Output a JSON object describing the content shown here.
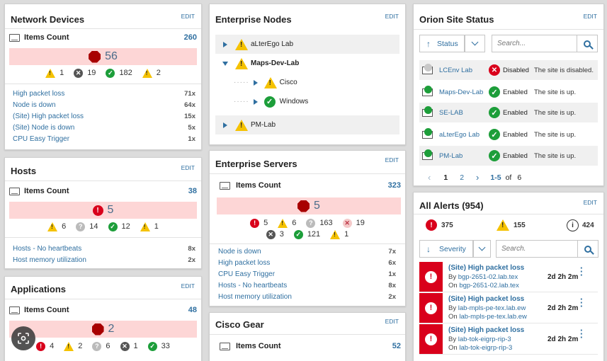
{
  "edit_label": "EDIT",
  "network_devices": {
    "title": "Network Devices",
    "count_label": "Items Count",
    "count_value": "260",
    "critical": "56",
    "stats": {
      "warning": "1",
      "unknown": "19",
      "ok": "182",
      "warning2": "2"
    },
    "alerts": [
      {
        "name": "High packet loss",
        "count": "71x"
      },
      {
        "name": "Node is down",
        "count": "64x"
      },
      {
        "name": "(Site) High packet loss",
        "count": "15x"
      },
      {
        "name": "(Site) Node is down",
        "count": "5x"
      },
      {
        "name": "CPU Easy Trigger",
        "count": "1x"
      }
    ]
  },
  "hosts": {
    "title": "Hosts",
    "count_label": "Items Count",
    "count_value": "38",
    "critical": "5",
    "stats": {
      "warning": "6",
      "unknown": "14",
      "ok": "12",
      "warning2": "1"
    },
    "alerts": [
      {
        "name": "Hosts - No heartbeats",
        "count": "8x"
      },
      {
        "name": "Host memory utilization",
        "count": "2x"
      }
    ]
  },
  "applications": {
    "title": "Applications",
    "count_label": "Items Count",
    "count_value": "48",
    "critical": "2",
    "stats": {
      "error": "4",
      "warning": "2",
      "unknown": "6",
      "down": "1",
      "ok": "33"
    }
  },
  "enterprise_nodes": {
    "title": "Enterprise Nodes",
    "items": [
      {
        "label": "aLterEgo Lab"
      },
      {
        "label": "Maps-Dev-Lab"
      },
      {
        "label": "Cisco"
      },
      {
        "label": "Windows"
      },
      {
        "label": "PM-Lab"
      }
    ]
  },
  "enterprise_servers": {
    "title": "Enterprise Servers",
    "count_label": "Items Count",
    "count_value": "323",
    "critical": "5",
    "stats": {
      "error": "5",
      "warning": "6",
      "unknown": "163",
      "x": "19",
      "down": "3",
      "ok": "121",
      "warning2": "1"
    },
    "alerts": [
      {
        "name": "Node is down",
        "count": "7x"
      },
      {
        "name": "High packet loss",
        "count": "6x"
      },
      {
        "name": "CPU Easy Trigger",
        "count": "1x"
      },
      {
        "name": "Hosts - No heartbeats",
        "count": "8x"
      },
      {
        "name": "Host memory utilization",
        "count": "2x"
      }
    ]
  },
  "cisco_gear": {
    "title": "Cisco Gear",
    "count_label": "Items Count",
    "count_value": "52"
  },
  "orion_site_status": {
    "title": "Orion Site Status",
    "sort_label": "Status",
    "search_placeholder": "Search...",
    "sites": [
      {
        "name": "LCEnv Lab",
        "status": "Disabled",
        "desc": "The site is disabled.",
        "state": "disabled"
      },
      {
        "name": "Maps-Dev-Lab",
        "status": "Enabled",
        "desc": "The site is up.",
        "state": "enabled"
      },
      {
        "name": "SE-LAB",
        "status": "Enabled",
        "desc": "The site is up.",
        "state": "enabled"
      },
      {
        "name": "aLterEgo Lab",
        "status": "Enabled",
        "desc": "The site is up.",
        "state": "enabled"
      },
      {
        "name": "PM-Lab",
        "status": "Enabled",
        "desc": "The site is up.",
        "state": "enabled"
      }
    ],
    "pager": {
      "page1": "1",
      "page2": "2",
      "range": "1-5",
      "of": "of",
      "total": "6"
    }
  },
  "all_alerts": {
    "title": "All Alerts (954)",
    "critical": "375",
    "warning": "155",
    "info": "424",
    "sort_label": "Severity",
    "search_placeholder": "Search.",
    "items": [
      {
        "title": "(Site) High packet loss",
        "by_label": "By",
        "by": "bgp-2651-02.lab.tex",
        "on_label": "On",
        "on": "bgp-2651-02.lab.tex",
        "time": "2d 2h 2m"
      },
      {
        "title": "(Site) High packet loss",
        "by_label": "By",
        "by": "lab-mpls-pe-tex.lab.ew",
        "on_label": "On",
        "on": "lab-mpls-pe-tex.lab.ew",
        "time": "2d 2h 2m"
      },
      {
        "title": "(Site) High packet loss",
        "by_label": "By",
        "by": "lab-tok-eigrp-rip-3",
        "on_label": "On",
        "on": "lab-tok-eigrp-rip-3",
        "time": "2d 2h 2m"
      }
    ]
  }
}
